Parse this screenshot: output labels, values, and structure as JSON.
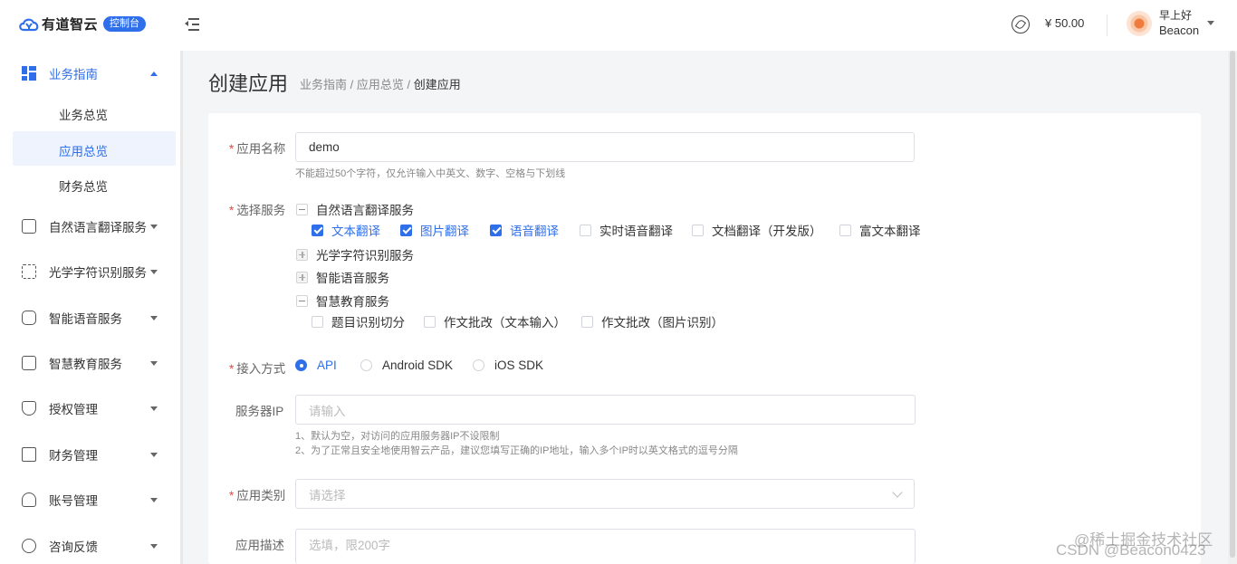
{
  "header": {
    "logo_text": "有道智云",
    "console_badge": "控制台",
    "balance": "¥ 50.00",
    "greeting": "早上好",
    "username": "Beacon",
    "brand_color": "#2f6fea"
  },
  "sidebar": {
    "guide": {
      "label": "业务指南",
      "children": [
        "业务总览",
        "应用总览",
        "财务总览"
      ]
    },
    "items": [
      {
        "label": "自然语言翻译服务",
        "icon": "translate-icon"
      },
      {
        "label": "光学字符识别服务",
        "icon": "scan-icon"
      },
      {
        "label": "智能语音服务",
        "icon": "voice-icon"
      },
      {
        "label": "智慧教育服务",
        "icon": "education-icon"
      },
      {
        "label": "授权管理",
        "icon": "shield-icon"
      },
      {
        "label": "财务管理",
        "icon": "finance-icon"
      },
      {
        "label": "账号管理",
        "icon": "user-icon"
      },
      {
        "label": "咨询反馈",
        "icon": "feedback-icon"
      }
    ]
  },
  "page": {
    "title": "创建应用",
    "breadcrumb": [
      "业务指南",
      "应用总览",
      "创建应用"
    ],
    "breadcrumb_sep": " / "
  },
  "form": {
    "app_name": {
      "label": "应用名称",
      "value": "demo",
      "hint": "不能超过50个字符，仅允许输入中英文、数字、空格与下划线"
    },
    "services": {
      "label": "选择服务",
      "groups": [
        {
          "name": "自然语言翻译服务",
          "expanded": true,
          "options": [
            {
              "label": "文本翻译",
              "checked": true
            },
            {
              "label": "图片翻译",
              "checked": true
            },
            {
              "label": "语音翻译",
              "checked": true
            },
            {
              "label": "实时语音翻译",
              "checked": false
            },
            {
              "label": "文档翻译（开发版）",
              "checked": false
            },
            {
              "label": "富文本翻译",
              "checked": false
            }
          ]
        },
        {
          "name": "光学字符识别服务",
          "expanded": false,
          "options": []
        },
        {
          "name": "智能语音服务",
          "expanded": false,
          "options": []
        },
        {
          "name": "智慧教育服务",
          "expanded": true,
          "options": [
            {
              "label": "题目识别切分",
              "checked": false
            },
            {
              "label": "作文批改（文本输入）",
              "checked": false
            },
            {
              "label": "作文批改（图片识别）",
              "checked": false
            }
          ]
        }
      ]
    },
    "access": {
      "label": "接入方式",
      "options": [
        "API",
        "Android SDK",
        "iOS SDK"
      ],
      "selected": "API"
    },
    "server_ip": {
      "label": "服务器IP",
      "placeholder": "请输入",
      "hint_1": "1、默认为空，对访问的应用服务器IP不设限制",
      "hint_2": "2、为了正常且安全地使用智云产品，建议您填写正确的IP地址，输入多个IP时以英文格式的逗号分隔"
    },
    "category": {
      "label": "应用类别",
      "placeholder": "请选择"
    },
    "description": {
      "label": "应用描述",
      "placeholder": "选填，限200字"
    }
  },
  "watermark": {
    "line1": "@稀土掘金技术社区",
    "line2": "CSDN @Beacon0423"
  }
}
